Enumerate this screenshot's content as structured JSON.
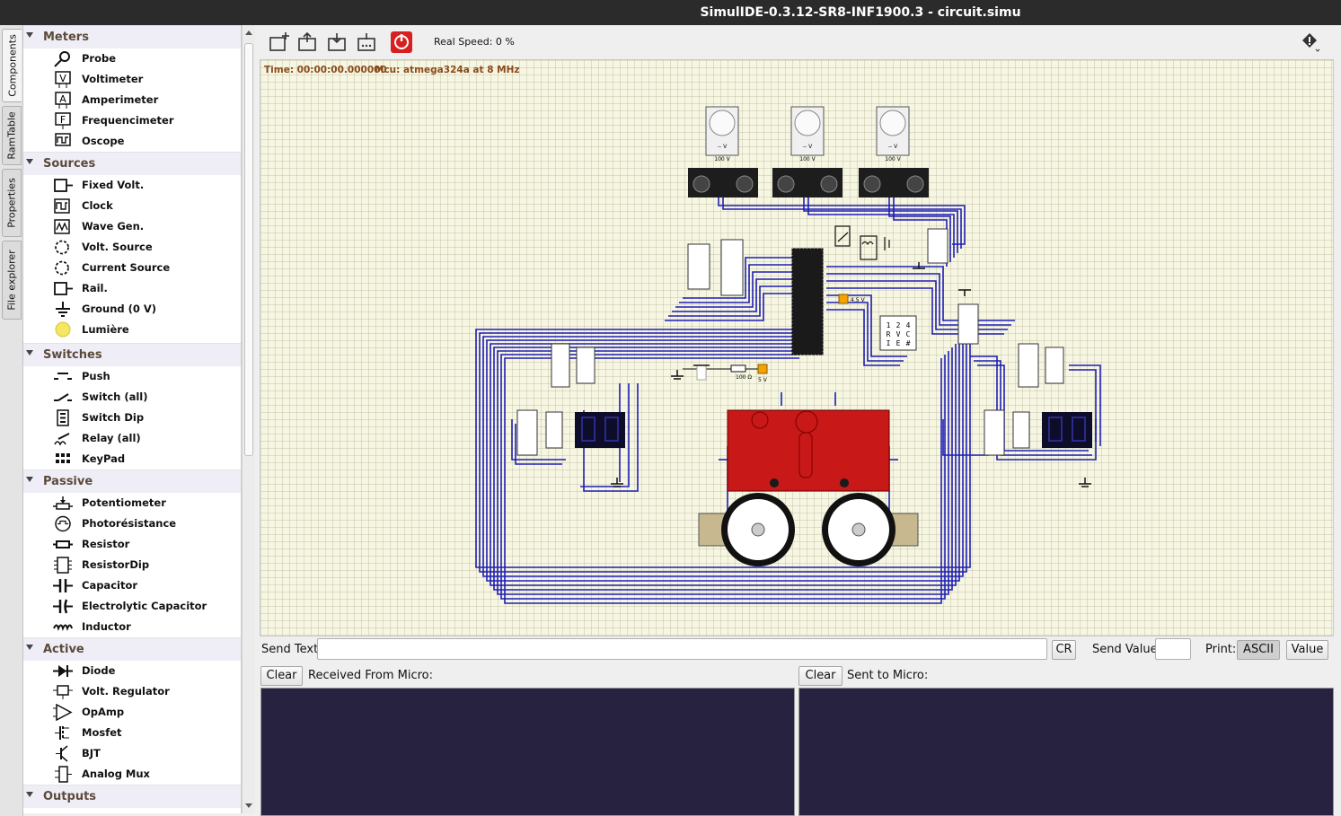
{
  "window": {
    "title": "SimulIDE-0.3.12-SR8-INF1900.3  -  circuit.simu"
  },
  "side_tabs": [
    "Components",
    "RamTable",
    "Properties",
    "File explorer"
  ],
  "palette": [
    {
      "category": "Meters",
      "items": [
        {
          "label": "Probe",
          "icon": "probe-icon"
        },
        {
          "label": "Voltimeter",
          "icon": "voltimeter-icon"
        },
        {
          "label": "Amperimeter",
          "icon": "amperimeter-icon"
        },
        {
          "label": "Frequencimeter",
          "icon": "frequencimeter-icon"
        },
        {
          "label": "Oscope",
          "icon": "oscope-icon"
        }
      ]
    },
    {
      "category": "Sources",
      "items": [
        {
          "label": "Fixed Volt.",
          "icon": "fixed-volt-icon"
        },
        {
          "label": "Clock",
          "icon": "clock-icon"
        },
        {
          "label": "Wave Gen.",
          "icon": "wave-gen-icon"
        },
        {
          "label": "Volt. Source",
          "icon": "volt-source-icon"
        },
        {
          "label": "Current Source",
          "icon": "current-source-icon"
        },
        {
          "label": "Rail.",
          "icon": "rail-icon"
        },
        {
          "label": "Ground (0 V)",
          "icon": "ground-icon"
        },
        {
          "label": "Lumière",
          "icon": "lightbulb-icon"
        }
      ]
    },
    {
      "category": "Switches",
      "items": [
        {
          "label": "Push",
          "icon": "push-icon"
        },
        {
          "label": "Switch (all)",
          "icon": "switch-icon"
        },
        {
          "label": "Switch Dip",
          "icon": "switch-dip-icon"
        },
        {
          "label": "Relay (all)",
          "icon": "relay-icon"
        },
        {
          "label": "KeyPad",
          "icon": "keypad-icon"
        }
      ]
    },
    {
      "category": "Passive",
      "items": [
        {
          "label": "Potentiometer",
          "icon": "potentiometer-icon"
        },
        {
          "label": "Photorésistance",
          "icon": "photoresistance-icon"
        },
        {
          "label": "Resistor",
          "icon": "resistor-icon"
        },
        {
          "label": "ResistorDip",
          "icon": "resistor-dip-icon"
        },
        {
          "label": "Capacitor",
          "icon": "capacitor-icon"
        },
        {
          "label": "Electrolytic Capacitor",
          "icon": "electrolytic-capacitor-icon"
        },
        {
          "label": "Inductor",
          "icon": "inductor-icon"
        }
      ]
    },
    {
      "category": "Active",
      "items": [
        {
          "label": "Diode",
          "icon": "diode-icon"
        },
        {
          "label": "Volt. Regulator",
          "icon": "volt-regulator-icon"
        },
        {
          "label": "OpAmp",
          "icon": "opamp-icon"
        },
        {
          "label": "Mosfet",
          "icon": "mosfet-icon"
        },
        {
          "label": "BJT",
          "icon": "bjt-icon"
        },
        {
          "label": "Analog Mux",
          "icon": "analog-mux-icon"
        }
      ]
    },
    {
      "category": "Outputs",
      "items": []
    }
  ],
  "toolbar": {
    "buttons": [
      "new-circuit-icon",
      "open-circuit-icon",
      "save-circuit-icon",
      "save-as-icon",
      "power-icon"
    ],
    "real_speed": "Real Speed: 0 %",
    "info_icon": "info-icon"
  },
  "canvas": {
    "time": "Time: 00:00:00.000000",
    "mcu": "Mcu: atmega324a at 8 MHz",
    "labels": {
      "meter_1": "100 V",
      "meter_2": "100 V",
      "meter_3": "100 V",
      "meter_reading": "-- V",
      "resistor": "100 Ω",
      "rail_5v": "5 V",
      "rail_45v": "4.5 V",
      "keypad_keys": [
        "1",
        "2",
        "4",
        "R",
        "V",
        "C",
        "I",
        "E",
        "#"
      ]
    }
  },
  "serial": {
    "send_text_label": "Send Text:",
    "send_text_value": "",
    "cr_label": "CR",
    "send_value_label": "Send Value:",
    "send_value": "",
    "print_label": "Print:",
    "ascii_label": "ASCII",
    "value_label": "Value",
    "clear_left": "Clear",
    "received_label": "Received From Micro:",
    "clear_right": "Clear",
    "sent_label": "Sent to Micro:"
  },
  "colors": {
    "title_bg": "#2b2b2b",
    "terminal_bg": "#262240",
    "wire": "#1f1fb5",
    "board": "#c81818",
    "category_text": "#5b4a3a"
  }
}
